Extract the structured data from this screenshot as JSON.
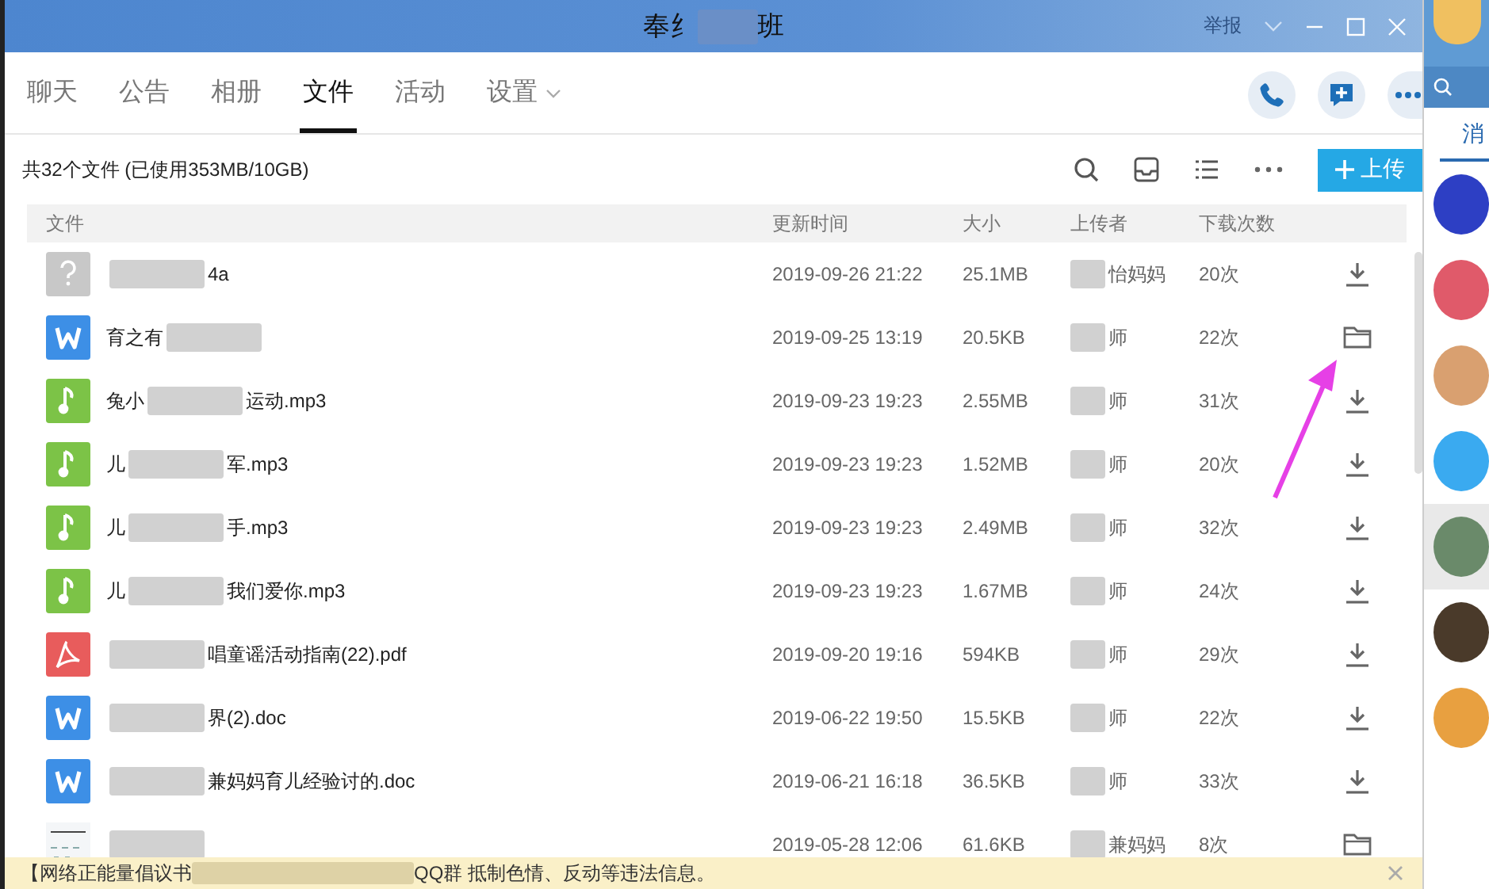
{
  "window": {
    "title_start": "奉纟",
    "title_end": "班",
    "report": "举报"
  },
  "tabs": [
    {
      "label": "聊天",
      "selected": false
    },
    {
      "label": "公告",
      "selected": false
    },
    {
      "label": "相册",
      "selected": false
    },
    {
      "label": "文件",
      "selected": true
    },
    {
      "label": "活动",
      "selected": false
    },
    {
      "label": "设置",
      "selected": false,
      "dropdown": true
    }
  ],
  "summary": "共32个文件 (已使用353MB/10GB)",
  "upload_button": "上传",
  "table": {
    "columns": [
      "文件",
      "更新时间",
      "大小",
      "上传者",
      "下载次数"
    ],
    "rows": [
      {
        "kind": "unknown",
        "name_start": "",
        "name_end": "4a",
        "time": "2019-09-26 21:22",
        "size": "25.1MB",
        "uploader": "怡妈妈",
        "downloads": "20次",
        "action": {
          "kind": "download"
        }
      },
      {
        "kind": "doc",
        "name_start": "育之有",
        "name_end": "",
        "time": "2019-09-25 13:19",
        "size": "20.5KB",
        "uploader": "师",
        "downloads": "22次",
        "action": {
          "kind": "folder"
        }
      },
      {
        "kind": "music",
        "name_start": "兔小",
        "name_end": "运动.mp3",
        "time": "2019-09-23 19:23",
        "size": "2.55MB",
        "uploader": "师",
        "downloads": "31次",
        "action": {
          "kind": "download"
        }
      },
      {
        "kind": "music",
        "name_start": "儿",
        "name_end": "军.mp3",
        "time": "2019-09-23 19:23",
        "size": "1.52MB",
        "uploader": "师",
        "downloads": "20次",
        "action": {
          "kind": "download"
        }
      },
      {
        "kind": "music",
        "name_start": "儿",
        "name_end": "手.mp3",
        "time": "2019-09-23 19:23",
        "size": "2.49MB",
        "uploader": "师",
        "downloads": "32次",
        "action": {
          "kind": "download"
        }
      },
      {
        "kind": "music",
        "name_start": "儿",
        "name_end": "我们爱你.mp3",
        "time": "2019-09-23 19:23",
        "size": "1.67MB",
        "uploader": "师",
        "downloads": "24次",
        "action": {
          "kind": "download"
        }
      },
      {
        "kind": "pdf",
        "name_start": "",
        "name_end": "唱童谣活动指南(22).pdf",
        "time": "2019-09-20 19:16",
        "size": "594KB",
        "uploader": "师",
        "downloads": "29次",
        "action": {
          "kind": "download"
        }
      },
      {
        "kind": "doc",
        "name_start": "",
        "name_end": "界(2).doc",
        "time": "2019-06-22 19:50",
        "size": "15.5KB",
        "uploader": "师",
        "downloads": "22次",
        "action": {
          "kind": "download"
        }
      },
      {
        "kind": "doc",
        "name_start": "",
        "name_end": "兼妈妈育儿经验讨的.doc",
        "time": "2019-06-21 16:18",
        "size": "36.5KB",
        "uploader": "师",
        "downloads": "33次",
        "action": {
          "kind": "download"
        }
      },
      {
        "kind": "image",
        "name_start": "",
        "name_end": "",
        "time": "2019-05-28 12:06",
        "size": "61.6KB",
        "uploader": "兼妈妈",
        "downloads": "8次",
        "action": {
          "kind": "folder"
        }
      }
    ]
  },
  "notice": {
    "start": "【网络正能量倡议书",
    "end": "QQ群 抵制色情、反动等违法信息。"
  },
  "side_panel": {
    "tab": "消",
    "avatars": [
      {
        "color": "#2d3fc4"
      },
      {
        "color": "#e05a6a"
      },
      {
        "color": "#d9a070"
      },
      {
        "color": "#3aaaf0"
      },
      {
        "color": "#6a8a6a"
      },
      {
        "color": "#4a3a2a"
      },
      {
        "color": "#e8a040"
      }
    ]
  }
}
